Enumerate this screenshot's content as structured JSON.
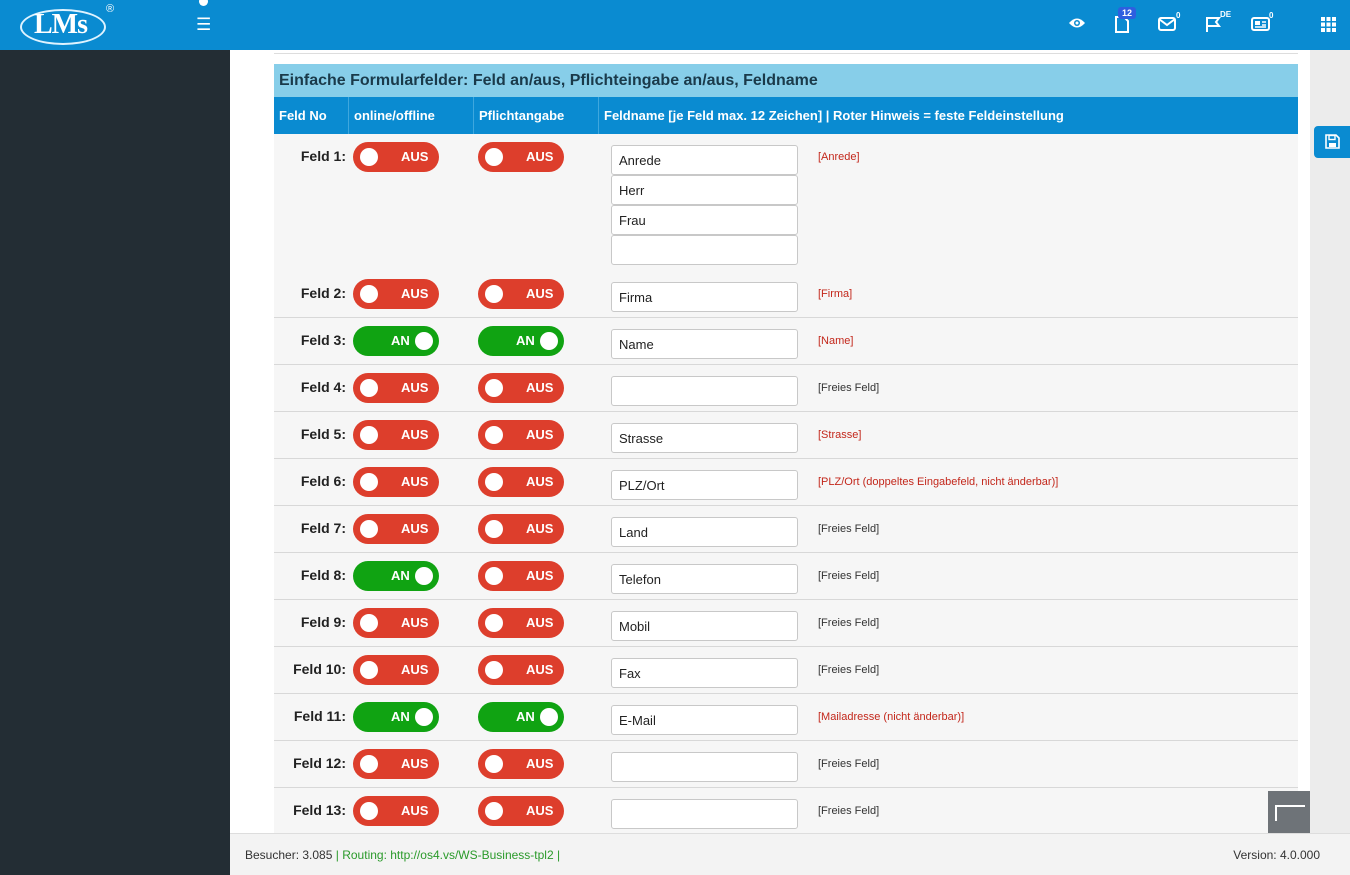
{
  "brand": {
    "logo_text": "LMs",
    "logo_reg": "®"
  },
  "topbar": {
    "menu_icon": "hamburger-icon",
    "icons": [
      {
        "name": "eye-icon"
      },
      {
        "name": "document-icon",
        "badge": "12"
      },
      {
        "name": "mail-icon",
        "badge": "0"
      },
      {
        "name": "flag-icon",
        "badge": "DE"
      },
      {
        "name": "newspaper-icon",
        "badge": "0"
      },
      {
        "name": "apps-grid-icon"
      }
    ]
  },
  "section": {
    "title": "Einfache Formularfelder: Feld an/aus, Pflichteingabe an/aus, Feldname",
    "headers": {
      "no": "Feld No",
      "online": "online/offline",
      "required": "Pflichtangabe",
      "name": "Feldname [je Feld max. 12 Zeichen] | Roter Hinweis = feste Feldeinstellung"
    }
  },
  "toggle_labels": {
    "on": "AN",
    "off": "AUS"
  },
  "fields": [
    {
      "label": "Feld 1:",
      "online": "AUS",
      "required": "AUS",
      "values": [
        "Anrede",
        "Herr",
        "Frau",
        ""
      ],
      "hint": "[Anrede]",
      "hint_fixed": true
    },
    {
      "label": "Feld 2:",
      "online": "AUS",
      "required": "AUS",
      "values": [
        "Firma"
      ],
      "hint": "[Firma]",
      "hint_fixed": true
    },
    {
      "label": "Feld 3:",
      "online": "AN",
      "required": "AN",
      "values": [
        "Name"
      ],
      "hint": "[Name]",
      "hint_fixed": true
    },
    {
      "label": "Feld 4:",
      "online": "AUS",
      "required": "AUS",
      "values": [
        ""
      ],
      "hint": "[Freies Feld]",
      "hint_fixed": false
    },
    {
      "label": "Feld 5:",
      "online": "AUS",
      "required": "AUS",
      "values": [
        "Strasse"
      ],
      "hint": "[Strasse]",
      "hint_fixed": true
    },
    {
      "label": "Feld 6:",
      "online": "AUS",
      "required": "AUS",
      "values": [
        "PLZ/Ort"
      ],
      "hint": "[PLZ/Ort (doppeltes Eingabefeld, nicht änderbar)]",
      "hint_fixed": true
    },
    {
      "label": "Feld 7:",
      "online": "AUS",
      "required": "AUS",
      "values": [
        "Land"
      ],
      "hint": "[Freies Feld]",
      "hint_fixed": false
    },
    {
      "label": "Feld 8:",
      "online": "AN",
      "required": "AUS",
      "values": [
        "Telefon"
      ],
      "hint": "[Freies Feld]",
      "hint_fixed": false
    },
    {
      "label": "Feld 9:",
      "online": "AUS",
      "required": "AUS",
      "values": [
        "Mobil"
      ],
      "hint": "[Freies Feld]",
      "hint_fixed": false
    },
    {
      "label": "Feld 10:",
      "online": "AUS",
      "required": "AUS",
      "values": [
        "Fax"
      ],
      "hint": "[Freies Feld]",
      "hint_fixed": false
    },
    {
      "label": "Feld 11:",
      "online": "AN",
      "required": "AN",
      "values": [
        "E-Mail"
      ],
      "hint": "[Mailadresse (nicht änderbar)]",
      "hint_fixed": true
    },
    {
      "label": "Feld 12:",
      "online": "AUS",
      "required": "AUS",
      "values": [
        ""
      ],
      "hint": "[Freies Feld]",
      "hint_fixed": false
    },
    {
      "label": "Feld 13:",
      "online": "AUS",
      "required": "AUS",
      "values": [
        ""
      ],
      "hint": "[Freies Feld]",
      "hint_fixed": false
    }
  ],
  "footer": {
    "visitors": "Besucher: 3.085",
    "sep1": "|",
    "routing": "Routing: http://os4.vs/WS-Business-tpl2",
    "sep2": "|",
    "version": "Version: 4.0.000"
  },
  "colors": {
    "primary": "#0a8bd1",
    "section": "#87cee9",
    "on": "#10a312",
    "off": "#dd3e2c",
    "sidebar": "#232d34"
  }
}
